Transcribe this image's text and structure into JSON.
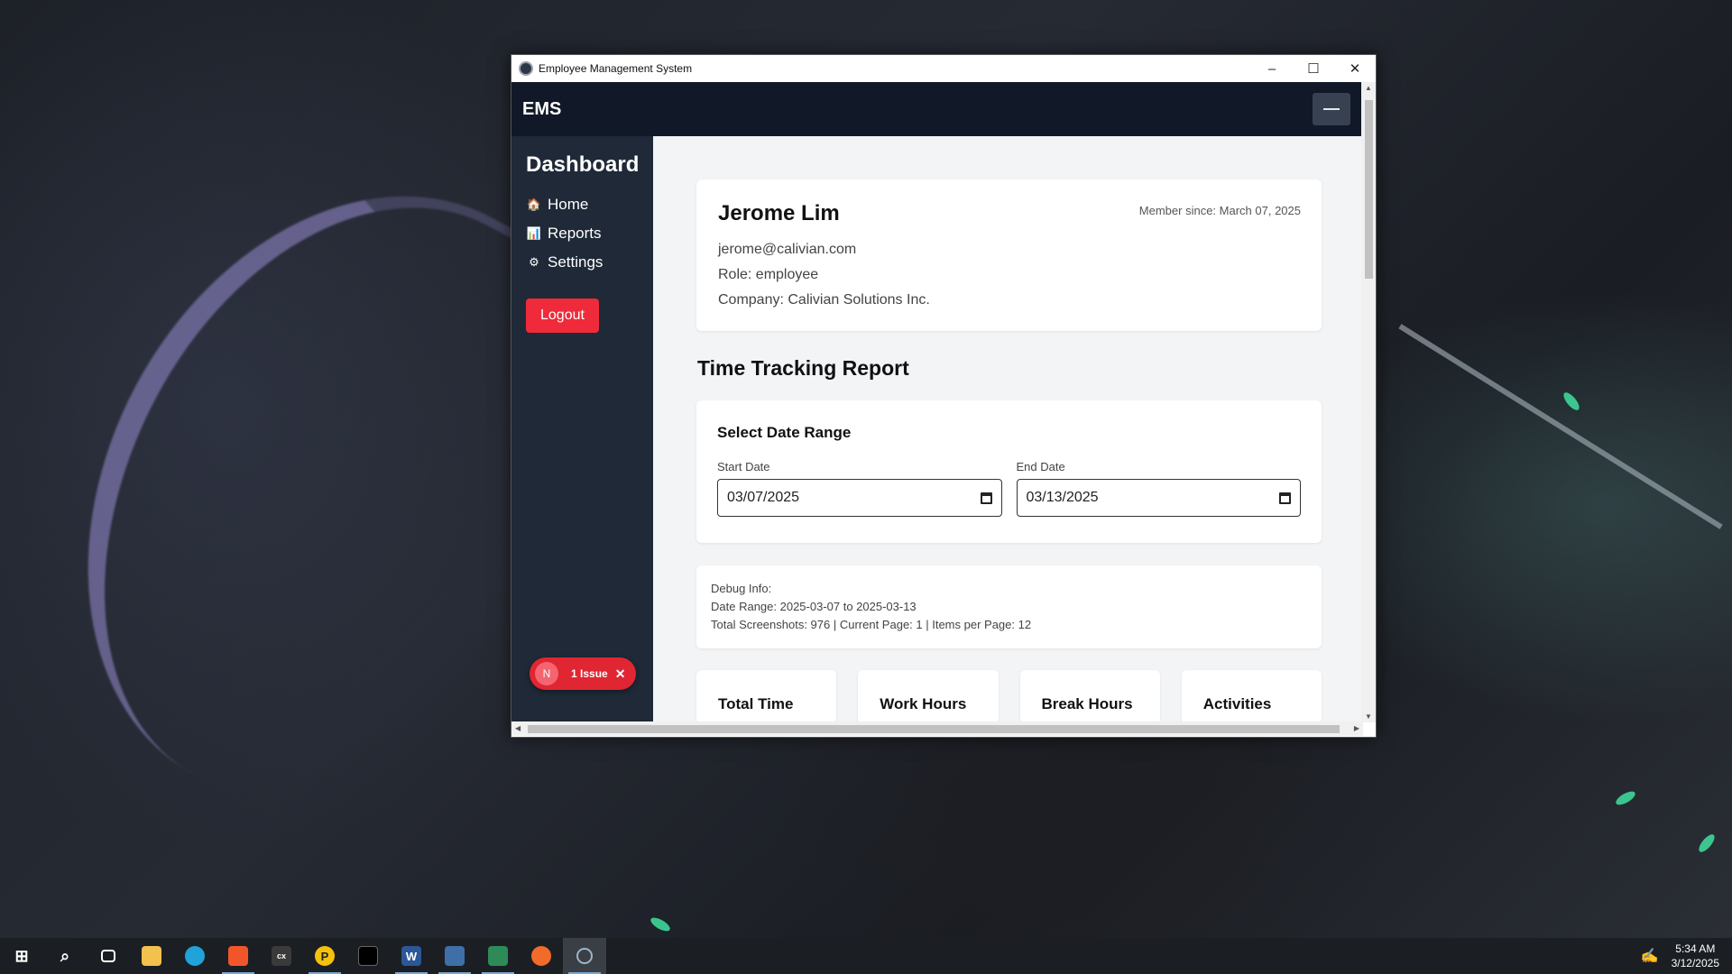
{
  "window": {
    "title": "Employee Management System"
  },
  "app": {
    "brand": "EMS",
    "sidebar": {
      "title": "Dashboard",
      "items": [
        {
          "icon": "🏠",
          "label": "Home"
        },
        {
          "icon": "📊",
          "label": "Reports"
        },
        {
          "icon": "⚙",
          "label": "Settings"
        }
      ],
      "logout_label": "Logout"
    },
    "issues_badge": {
      "avatar": "N",
      "label": "1 Issue",
      "close": "✕"
    }
  },
  "profile": {
    "name": "Jerome Lim",
    "email": "jerome@calivian.com",
    "role": "Role: employee",
    "company": "Company: Calivian Solutions Inc.",
    "member_since": "Member since: March 07, 2025"
  },
  "report": {
    "title": "Time Tracking Report",
    "date_range": {
      "heading": "Select Date Range",
      "start_label": "Start Date",
      "start_value": "03/07/2025",
      "end_label": "End Date",
      "end_value": "03/13/2025"
    },
    "debug": {
      "line1": "Debug Info:",
      "line2": "Date Range: 2025-03-07 to 2025-03-13",
      "line3": "Total Screenshots: 976 | Current Page: 1 | Items per Page: 12"
    },
    "stats": [
      {
        "label": "Total Time"
      },
      {
        "label": "Work Hours"
      },
      {
        "label": "Break Hours"
      },
      {
        "label": "Activities"
      }
    ]
  },
  "taskbar": {
    "apps": [
      "start",
      "search",
      "task-view",
      "file-explorer",
      "edge",
      "brave",
      "terminal",
      "app-yellow",
      "app-black",
      "word",
      "app-blue",
      "excel",
      "app-orange",
      "electron-app"
    ],
    "time": "5:34 AM",
    "date": "3/12/2025"
  }
}
